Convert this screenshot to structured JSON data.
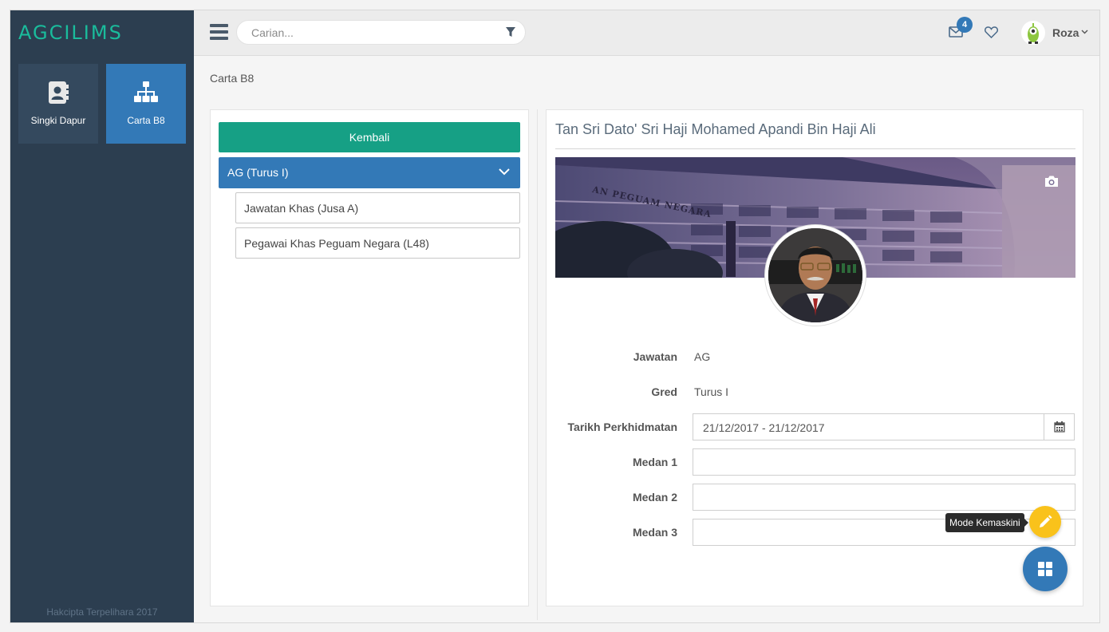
{
  "app": {
    "logo_text": "AGCILIMS",
    "brand_color": "#1abc9c"
  },
  "sidebar": {
    "tiles": [
      {
        "label": "Singki Dapur",
        "icon": "contact-book-icon",
        "active": false
      },
      {
        "label": "Carta B8",
        "icon": "org-chart-icon",
        "active": true
      }
    ],
    "copyright": "Hakcipta Terpelihara 2017"
  },
  "topbar": {
    "search_placeholder": "Carian...",
    "notifications_count": "4",
    "username": "Roza"
  },
  "breadcrumb": "Carta B8",
  "left_panel": {
    "back_button": "Kembali",
    "accordion_header": "AG (Turus I)",
    "items": [
      "Jawatan Khas (Jusa A)",
      "Pegawai Khas Peguam Negara (L48)"
    ]
  },
  "profile": {
    "name": "Tan Sri Dato' Sri Haji Mohamed Apandi Bin Haji Ali",
    "cover_caption": "AN PEGUAM NEGARA",
    "fields": {
      "jawatan_label": "Jawatan",
      "jawatan_value": "AG",
      "gred_label": "Gred",
      "gred_value": "Turus I",
      "tarikh_label": "Tarikh Perkhidmatan",
      "tarikh_value": "21/12/2017 - 21/12/2017",
      "medan1_label": "Medan 1",
      "medan1_value": "",
      "medan2_label": "Medan 2",
      "medan2_value": "",
      "medan3_label": "Medan 3",
      "medan3_value": ""
    }
  },
  "fab": {
    "edit_tooltip": "Mode Kemaskini",
    "edit_color": "#f9c21b",
    "main_color": "#3379b7"
  }
}
